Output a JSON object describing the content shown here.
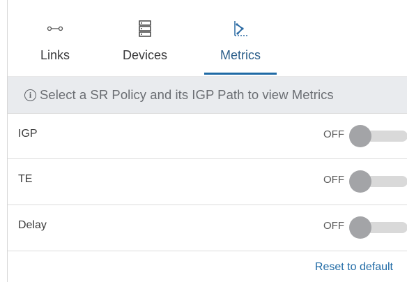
{
  "tabs": [
    {
      "label": "Links",
      "icon": "links-icon",
      "active": false
    },
    {
      "label": "Devices",
      "icon": "devices-icon",
      "active": false
    },
    {
      "label": "Metrics",
      "icon": "metrics-icon",
      "active": true
    }
  ],
  "info_bar": {
    "icon": "info-icon",
    "text": "Select a SR Policy and its IGP Path to view Metrics"
  },
  "metrics": [
    {
      "label": "IGP",
      "state_text": "OFF",
      "enabled": false
    },
    {
      "label": "TE",
      "state_text": "OFF",
      "enabled": false
    },
    {
      "label": "Delay",
      "state_text": "OFF",
      "enabled": false
    }
  ],
  "footer": {
    "reset_label": "Reset to default"
  },
  "colors": {
    "accent": "#1f6aa5",
    "info_bar_bg": "#e9ebee",
    "toggle_knob": "#a3a4a7",
    "toggle_track": "#d9d9d9"
  }
}
